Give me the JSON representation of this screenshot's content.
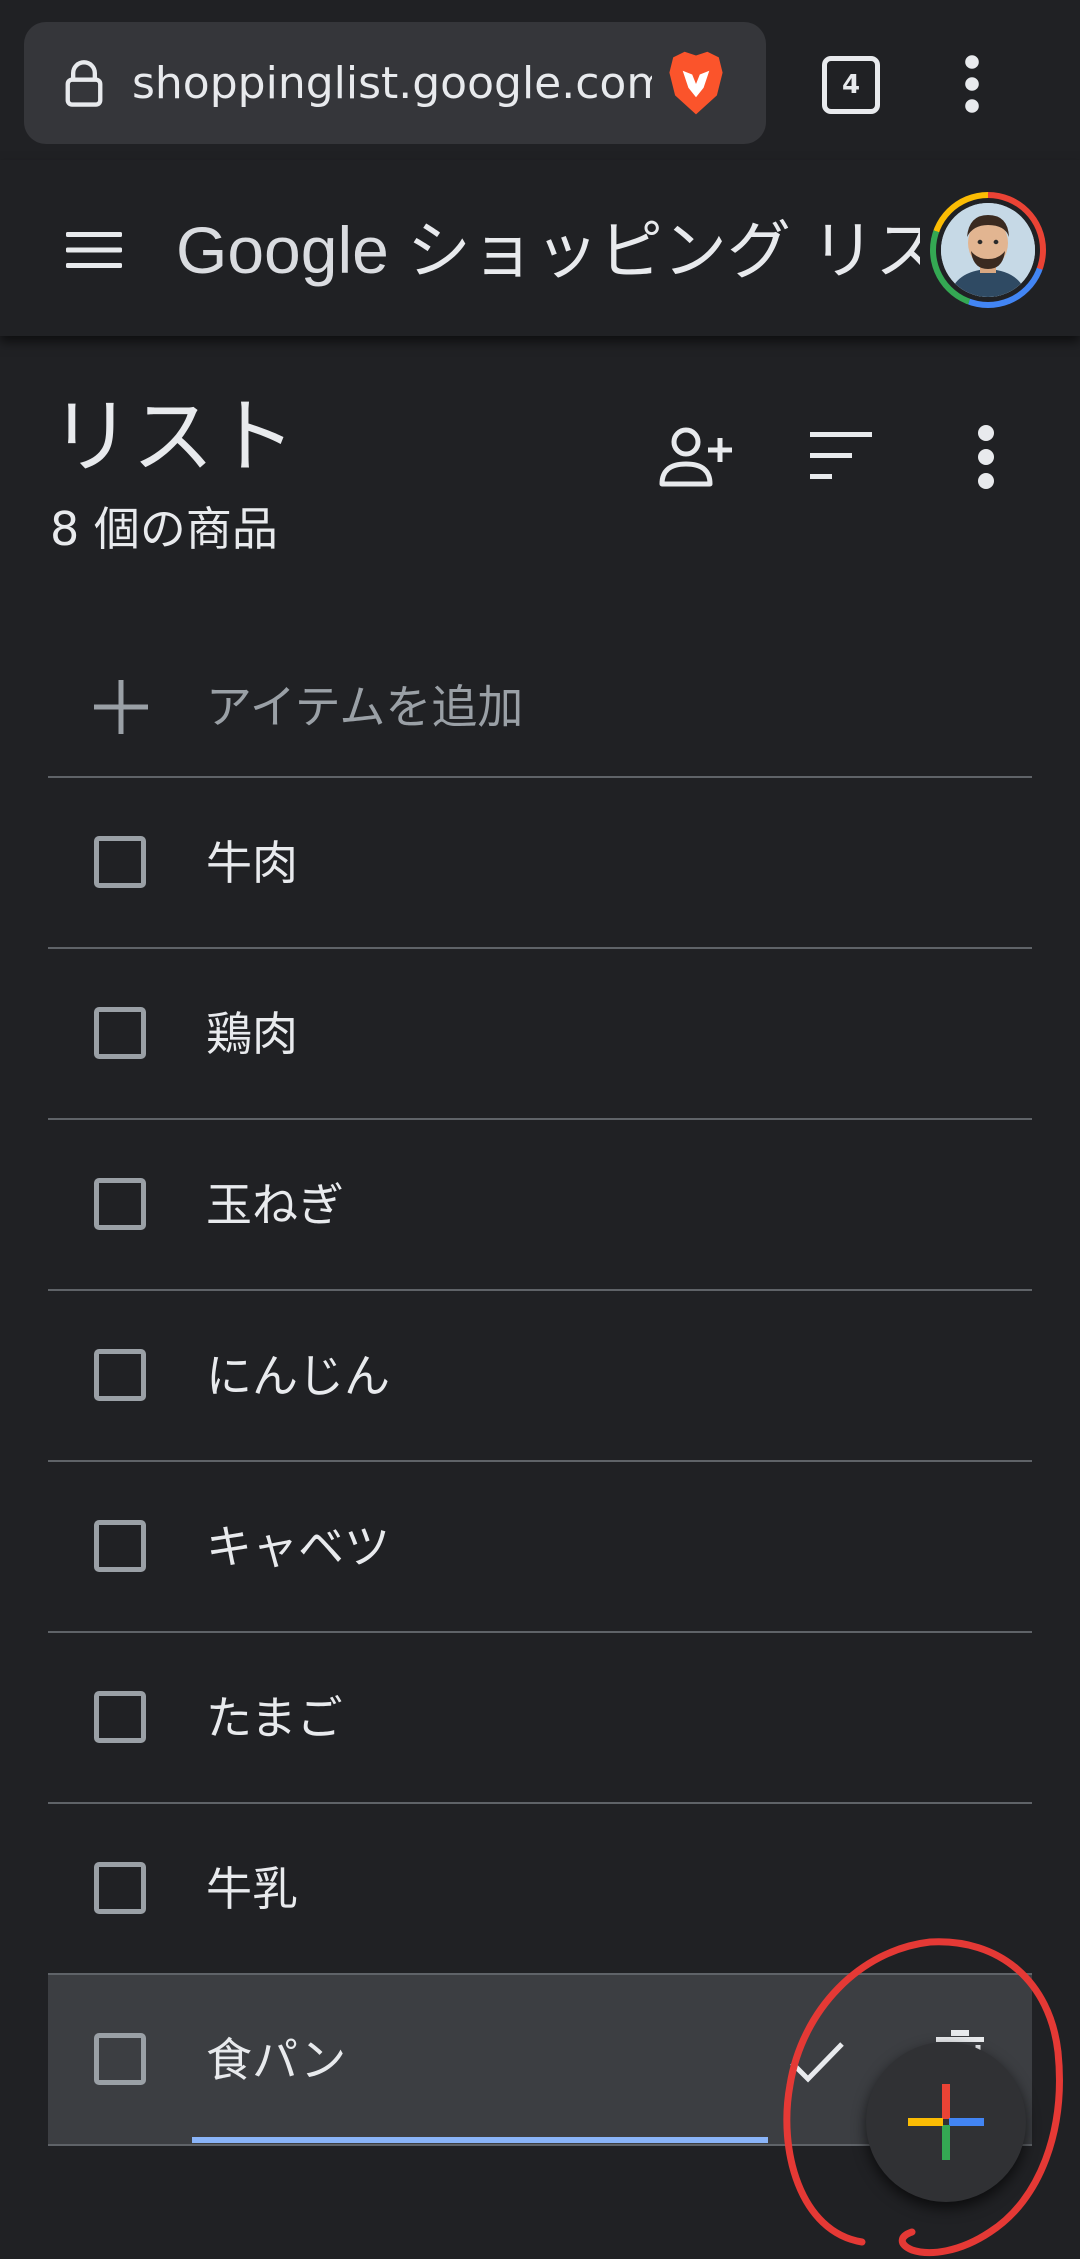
{
  "browser": {
    "url": "shoppinglist.google.com",
    "tab_count": "4"
  },
  "header": {
    "brand": "Google",
    "app_name": "ショッピング リスト"
  },
  "list": {
    "title": "リスト",
    "item_count": "8 個の商品",
    "add_item_label": "アイテムを追加"
  },
  "items": [
    {
      "label": "牛肉",
      "checked": false
    },
    {
      "label": "鶏肉",
      "checked": false
    },
    {
      "label": "玉ねぎ",
      "checked": false
    },
    {
      "label": "にんじん",
      "checked": false
    },
    {
      "label": "キャベツ",
      "checked": false
    },
    {
      "label": "たまご",
      "checked": false
    },
    {
      "label": "牛乳",
      "checked": false
    },
    {
      "label": "食パン",
      "checked": false,
      "editing": true
    }
  ],
  "colors": {
    "background": "#202124",
    "divider": "#5f6368",
    "edit_underline": "#8ab4f8",
    "annotation": "#e53935",
    "google_red": "#ea4335",
    "google_blue": "#4285f4",
    "google_green": "#34a853",
    "google_yellow": "#fbbc04"
  },
  "icons": [
    "lock-icon",
    "brave-lion-icon",
    "tabs-counter-icon",
    "more-vert-icon",
    "hamburger-icon",
    "avatar",
    "person-add-icon",
    "sort-icon",
    "plus-icon",
    "checkbox",
    "check-icon",
    "delete-icon",
    "google-plus-fab-icon"
  ]
}
